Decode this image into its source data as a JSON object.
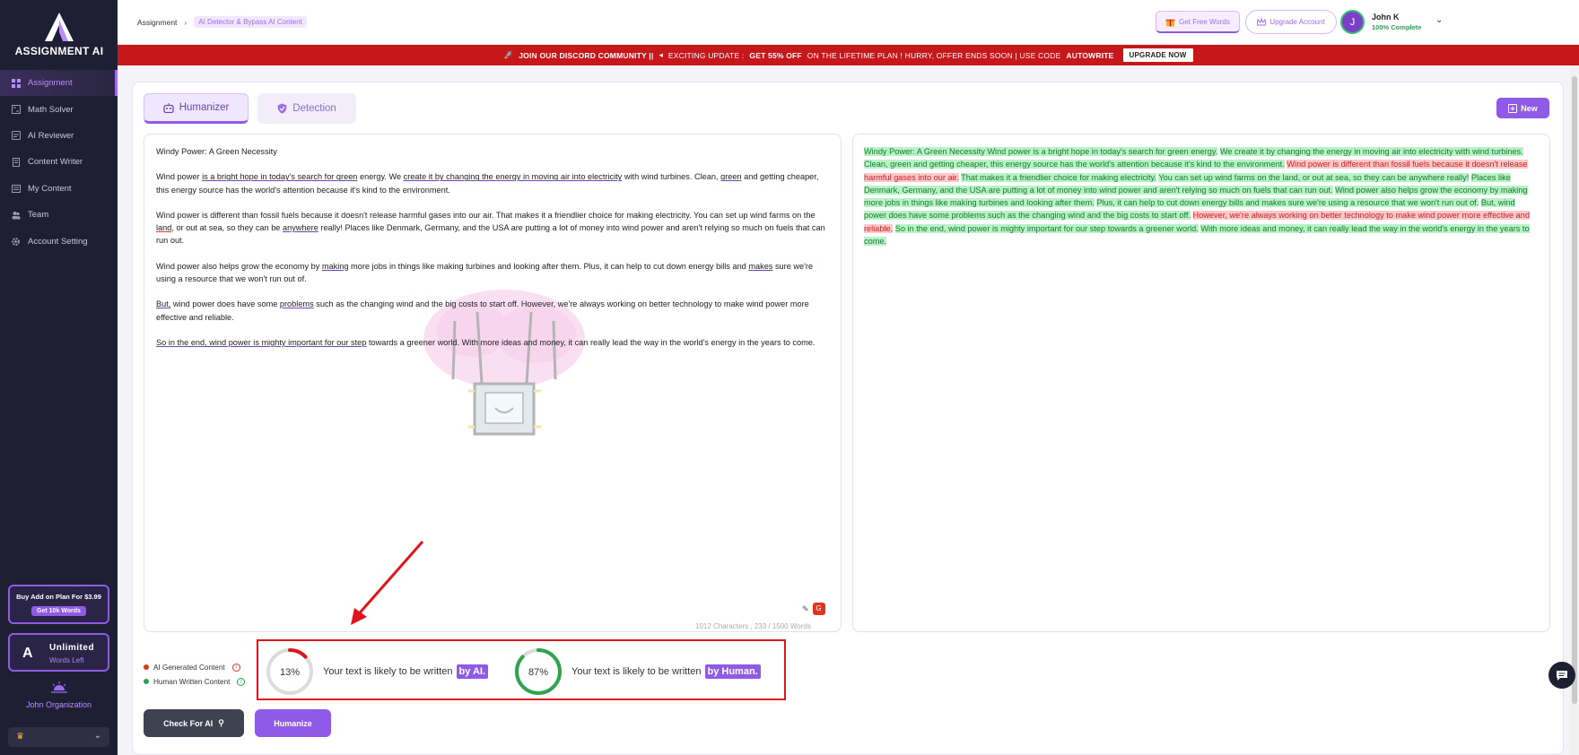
{
  "app": {
    "logo_text": "ASSIGNMENT AI"
  },
  "sidebar": {
    "items": [
      {
        "label": "Assignment",
        "icon": "grid-icon",
        "active": true
      },
      {
        "label": "Math Solver",
        "icon": "math-icon"
      },
      {
        "label": "AI Reviewer",
        "icon": "reviewer-icon"
      },
      {
        "label": "Content Writer",
        "icon": "document-icon"
      },
      {
        "label": "My Content",
        "icon": "folder-icon"
      },
      {
        "label": "Team",
        "icon": "team-icon"
      },
      {
        "label": "Account Setting",
        "icon": "gear-icon"
      }
    ],
    "promo": {
      "text": "Buy Add on Plan For $3.99",
      "button": "Get 10k Words"
    },
    "plan": {
      "title": "Unlimited",
      "subtitle": "Words Left"
    },
    "org_name": "John Organization"
  },
  "topbar": {
    "breadcrumb": [
      "Assignment",
      "AI Detector & Bypass AI Content"
    ],
    "free_words": "Get Free Words",
    "upgrade": "Upgrade Account",
    "avatar_initial": "J",
    "user_name": "John K",
    "profile_status": "100% Complete"
  },
  "banner": {
    "part1": "JOIN OUR DISCORD COMMUNITY ||",
    "part2": "EXCITING UPDATE :",
    "part3": "GET 55% OFF",
    "part4": "ON THE LIFETIME PLAN ! HURRY, OFFER ENDS SOON | USE CODE",
    "code": "AUTOWRITE",
    "button": "UPGRADE NOW"
  },
  "tabs": {
    "humanizer": "Humanizer",
    "detection": "Detection",
    "new_button": "New"
  },
  "editor": {
    "title": "Windy Power: A Green Necessity",
    "counter": "1012 Characters , 233 / 1500 Words"
  },
  "legend": {
    "ai": "AI Generated Content",
    "human": "Human Written Content"
  },
  "results": {
    "ai_percent": "13%",
    "ai_fraction": 0.13,
    "ai_text": "Your text is likely to be written",
    "ai_tag": "by AI.",
    "human_percent": "87%",
    "human_fraction": 0.87,
    "human_text": "Your text is likely to be written",
    "human_tag": "by Human."
  },
  "buttons": {
    "check": "Check For AI",
    "humanize": "Humanize"
  },
  "colors": {
    "accent": "#8e5ae6",
    "sidebar_bg": "#1f1f33",
    "banner_red": "#c8171b",
    "ai_red": "#e0141c",
    "human_green": "#2ea44f"
  }
}
